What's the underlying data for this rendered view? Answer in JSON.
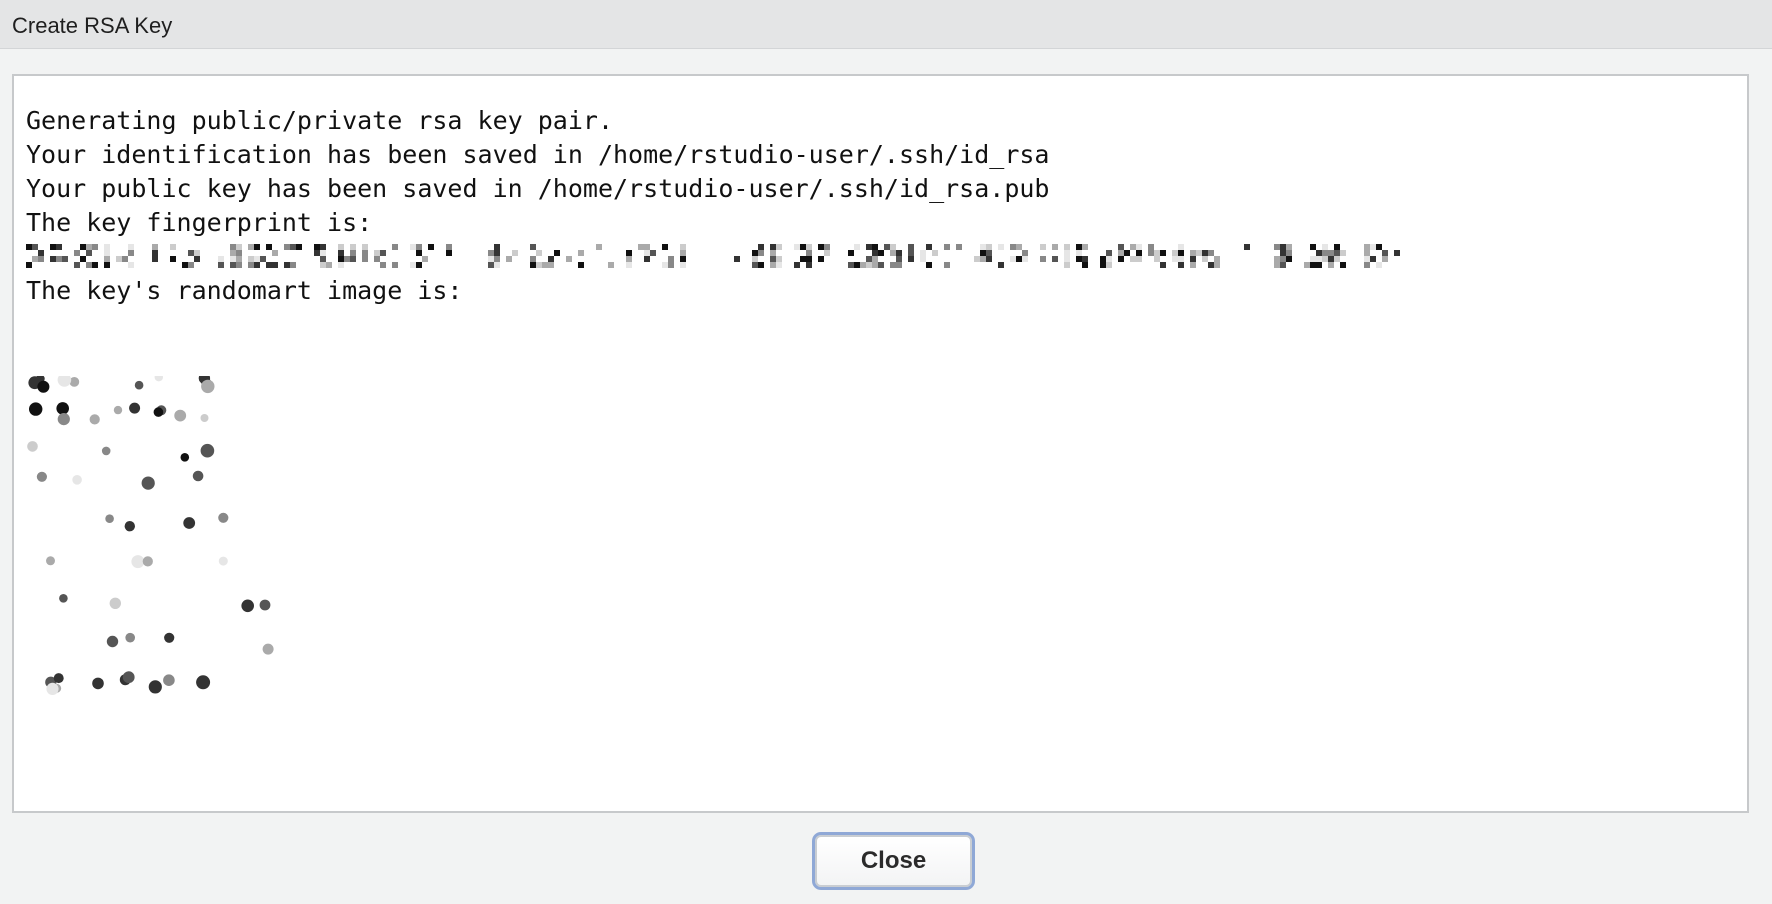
{
  "window": {
    "title": "Create RSA Key"
  },
  "output": {
    "lines_before": [
      "Generating public/private rsa key pair.",
      "Your identification has been saved in /home/rstudio-user/.ssh/id_rsa",
      "Your public key has been saved in /home/rstudio-user/.ssh/id_rsa.pub",
      "The key fingerprint is:"
    ],
    "randomart_label": "The key's randomart image is:",
    "fingerprint_redacted": true,
    "randomart_redacted": true
  },
  "footer": {
    "close_label": "Close"
  },
  "colors": {
    "titlebar": "#e4e5e6",
    "dialog_bg": "#f2f3f3",
    "output_bg": "#ffffff",
    "output_border": "#c7c9cb",
    "focus_ring": "#8fa8d6"
  }
}
